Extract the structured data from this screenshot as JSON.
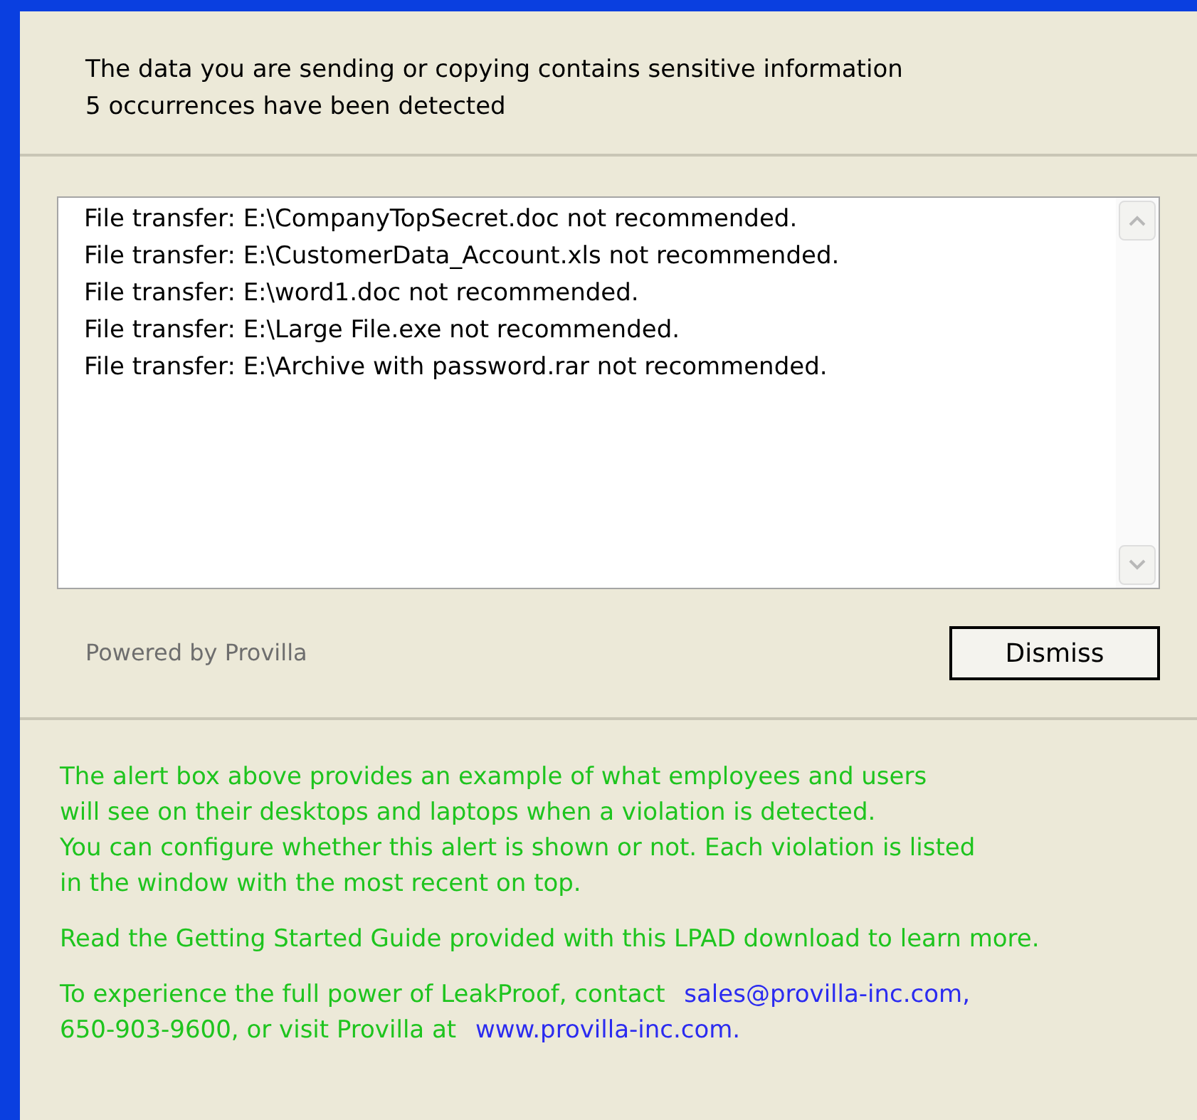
{
  "header": {
    "lines": [
      "The data you are sending or copying contains sensitive information",
      "5 occurrences have been detected"
    ]
  },
  "violations": [
    "File transfer: E:\\CompanyTopSecret.doc not recommended.",
    "File transfer: E:\\CustomerData_Account.xls not recommended.",
    "File transfer: E:\\word1.doc not recommended.",
    "File transfer: E:\\Large File.exe not recommended.",
    "File transfer: E:\\Archive with password.rar not recommended."
  ],
  "powered_by": "Powered by Provilla",
  "dismiss_button": "Dismiss",
  "info": [
    {
      "lines": [
        [
          {
            "kind": "text",
            "text": "The alert box above provides an example of what employees and users"
          }
        ],
        [
          {
            "kind": "text",
            "text": "will see on their desktops and laptops when a violation is detected."
          }
        ],
        [
          {
            "kind": "text",
            "text": "You can configure whether this alert is shown or not. Each violation is listed"
          }
        ],
        [
          {
            "kind": "text",
            "text": "in the window with the most recent on top."
          }
        ]
      ]
    },
    {
      "lines": [
        [
          {
            "kind": "text",
            "text": "Read the Getting Started Guide provided with this LPAD download to learn more."
          }
        ]
      ]
    },
    {
      "lines": [
        [
          {
            "kind": "text",
            "text": "To experience the full power of LeakProof, contact "
          },
          {
            "kind": "link",
            "text": "sales@provilla-inc.com,"
          }
        ],
        [
          {
            "kind": "text",
            "text": "650-903-9600, or visit Provilla at "
          },
          {
            "kind": "link",
            "text": "www.provilla-inc.com."
          }
        ]
      ]
    }
  ]
}
